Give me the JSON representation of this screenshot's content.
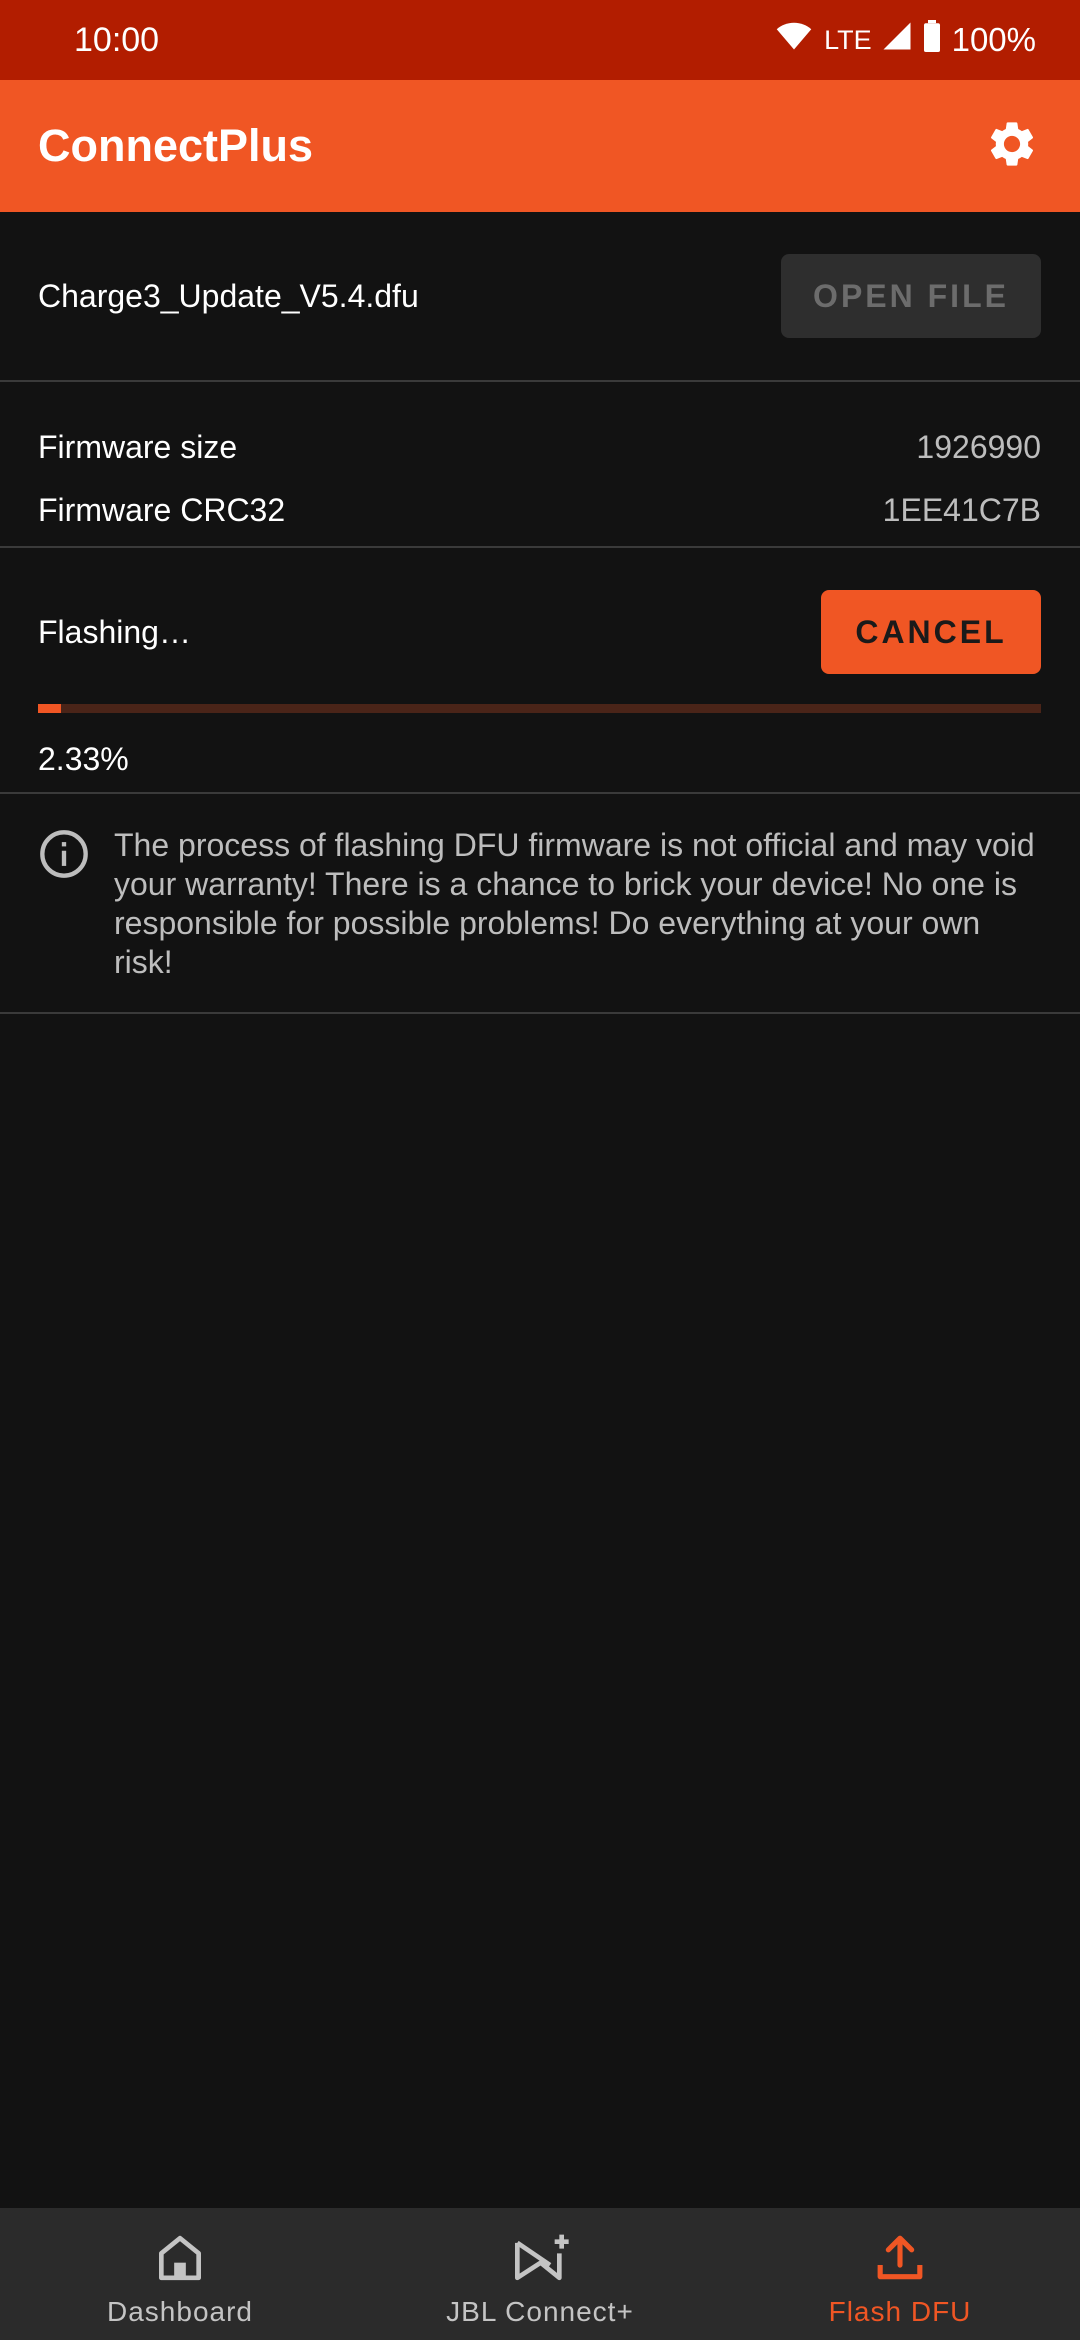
{
  "status_bar": {
    "time": "10:00",
    "network": "LTE",
    "battery": "100%"
  },
  "app_bar": {
    "title": "ConnectPlus",
    "settings_icon": "gear-icon"
  },
  "file_section": {
    "file_name": "Charge3_Update_V5.4.dfu",
    "open_file_label": "OPEN FILE"
  },
  "info_section": {
    "rows": [
      {
        "label": "Firmware size",
        "value": "1926990"
      },
      {
        "label": "Firmware CRC32",
        "value": "1EE41C7B"
      }
    ]
  },
  "flash_section": {
    "status": "Flashing…",
    "cancel_label": "CANCEL",
    "progress_percent": 2.33,
    "progress_text": "2.33%"
  },
  "warning": {
    "icon": "info-icon",
    "text": "The process of flashing DFU firmware is not official and may void your warranty! There is a chance to brick your device! No one is responsible for possible problems! Do everything at your own risk!"
  },
  "bottom_nav": {
    "items": [
      {
        "label": "Dashboard",
        "icon": "home-icon",
        "active": false
      },
      {
        "label": "JBL Connect+",
        "icon": "connect-icon",
        "active": false
      },
      {
        "label": "Flash DFU",
        "icon": "upload-icon",
        "active": true
      }
    ]
  },
  "colors": {
    "status_bar": "#b21d00",
    "accent": "#f05624",
    "background": "#121212",
    "nav_background": "#2b2b2b"
  }
}
